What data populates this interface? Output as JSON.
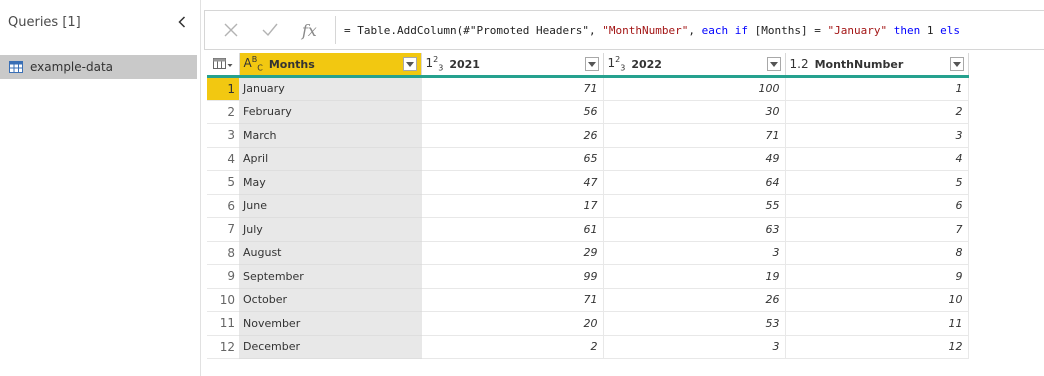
{
  "queries": {
    "title": "Queries [1]",
    "items": [
      {
        "label": "example-data",
        "icon": "table-icon"
      }
    ]
  },
  "formula_bar": {
    "formula_parts": [
      {
        "text": "= Table.AddColumn(#\"Promoted Headers\", ",
        "kind": "plain"
      },
      {
        "text": "\"MonthNumber\"",
        "kind": "str"
      },
      {
        "text": ", ",
        "kind": "plain"
      },
      {
        "text": "each if",
        "kind": "kw"
      },
      {
        "text": " [Months] = ",
        "kind": "plain"
      },
      {
        "text": "\"January\"",
        "kind": "str"
      },
      {
        "text": " ",
        "kind": "plain"
      },
      {
        "text": "then",
        "kind": "kw"
      },
      {
        "text": " 1 ",
        "kind": "plain"
      },
      {
        "text": "els",
        "kind": "kw"
      }
    ]
  },
  "grid": {
    "columns": [
      {
        "name": "Months",
        "type_icon": "ABC"
      },
      {
        "name": "2021",
        "type_icon": "123"
      },
      {
        "name": "2022",
        "type_icon": "123"
      },
      {
        "name": "MonthNumber",
        "type_icon": "1.2"
      }
    ],
    "rows": [
      {
        "n": "1",
        "month": "January",
        "y2021": "71",
        "y2022": "100",
        "mn": "1"
      },
      {
        "n": "2",
        "month": "February",
        "y2021": "56",
        "y2022": "30",
        "mn": "2"
      },
      {
        "n": "3",
        "month": "March",
        "y2021": "26",
        "y2022": "71",
        "mn": "3"
      },
      {
        "n": "4",
        "month": "April",
        "y2021": "65",
        "y2022": "49",
        "mn": "4"
      },
      {
        "n": "5",
        "month": "May",
        "y2021": "47",
        "y2022": "64",
        "mn": "5"
      },
      {
        "n": "6",
        "month": "June",
        "y2021": "17",
        "y2022": "55",
        "mn": "6"
      },
      {
        "n": "7",
        "month": "July",
        "y2021": "61",
        "y2022": "63",
        "mn": "7"
      },
      {
        "n": "8",
        "month": "August",
        "y2021": "29",
        "y2022": "3",
        "mn": "8"
      },
      {
        "n": "9",
        "month": "September",
        "y2021": "99",
        "y2022": "19",
        "mn": "9"
      },
      {
        "n": "10",
        "month": "October",
        "y2021": "71",
        "y2022": "26",
        "mn": "10"
      },
      {
        "n": "11",
        "month": "November",
        "y2021": "20",
        "y2022": "53",
        "mn": "11"
      },
      {
        "n": "12",
        "month": "December",
        "y2021": "2",
        "y2022": "3",
        "mn": "12"
      }
    ]
  },
  "colors": {
    "selected_column": "#f2c811",
    "header_underline": "#25a18e",
    "selected_query": "#c9c9c9"
  }
}
